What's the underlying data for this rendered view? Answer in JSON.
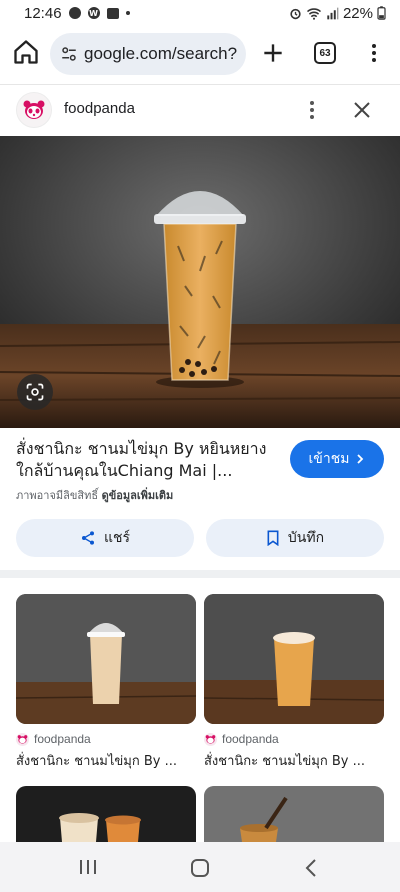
{
  "status_bar": {
    "time": "12:46",
    "battery": "22%",
    "left_icons": [
      "dot-icon",
      "w-icon",
      "image-icon",
      "dot-icon"
    ],
    "right_icons": [
      "alarm-icon",
      "wifi-icon",
      "signal-icon",
      "battery-icon"
    ]
  },
  "browser": {
    "url": "google.com/search?",
    "tab_count": "63"
  },
  "source": {
    "name": "foodpanda"
  },
  "result": {
    "title": "สั่งชานิกะ ชานมไข่มุก By หยินหยาง ใกล้บ้านคุณในChiang Mai |...",
    "visit_label": "เข้าชม",
    "copyright_prefix": "ภาพอาจมีลิขสิทธิ์",
    "copyright_link": "ดูข้อมูลเพิ่มเติม",
    "share_label": "แชร์",
    "save_label": "บันทึก"
  },
  "related": [
    {
      "source": "foodpanda",
      "title": "สั่งชานิกะ ชานมไข่มุก By ..."
    },
    {
      "source": "foodpanda",
      "title": "สั่งชานิกะ ชานมไข่มุก By ..."
    }
  ],
  "colors": {
    "accent": "#1a73e8",
    "pill_bg": "#eaf0f9",
    "foodpanda_pink": "#d70f64"
  },
  "nav": {
    "icons": [
      "recent-apps-icon",
      "home-icon",
      "back-icon"
    ]
  }
}
